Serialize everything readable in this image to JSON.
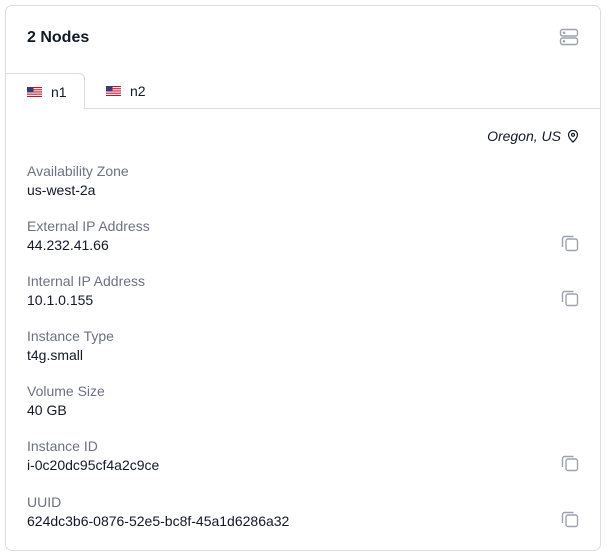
{
  "header": {
    "title": "2 Nodes",
    "icon": "server-icon"
  },
  "tabs": [
    {
      "label": "n1",
      "flag": "us-flag-icon",
      "active": true
    },
    {
      "label": "n2",
      "flag": "us-flag-icon",
      "active": false
    }
  ],
  "region": {
    "text": "Oregon, US",
    "icon": "map-pin-icon"
  },
  "fields": [
    {
      "label": "Availability Zone",
      "value": "us-west-2a",
      "copyable": false
    },
    {
      "label": "External IP Address",
      "value": "44.232.41.66",
      "copyable": true
    },
    {
      "label": "Internal IP Address",
      "value": "10.1.0.155",
      "copyable": true
    },
    {
      "label": "Instance Type",
      "value": "t4g.small",
      "copyable": false
    },
    {
      "label": "Volume Size",
      "value": "40 GB",
      "copyable": false
    },
    {
      "label": "Instance ID",
      "value": "i-0c20dc95cf4a2c9ce",
      "copyable": true
    },
    {
      "label": "UUID",
      "value": "624dc3b6-0876-52e5-bc8f-45a1d6286a32",
      "copyable": true
    }
  ],
  "colors": {
    "label": "#6b7280",
    "text": "#111827",
    "border": "#d9dce1",
    "icon": "#9ca3af"
  }
}
